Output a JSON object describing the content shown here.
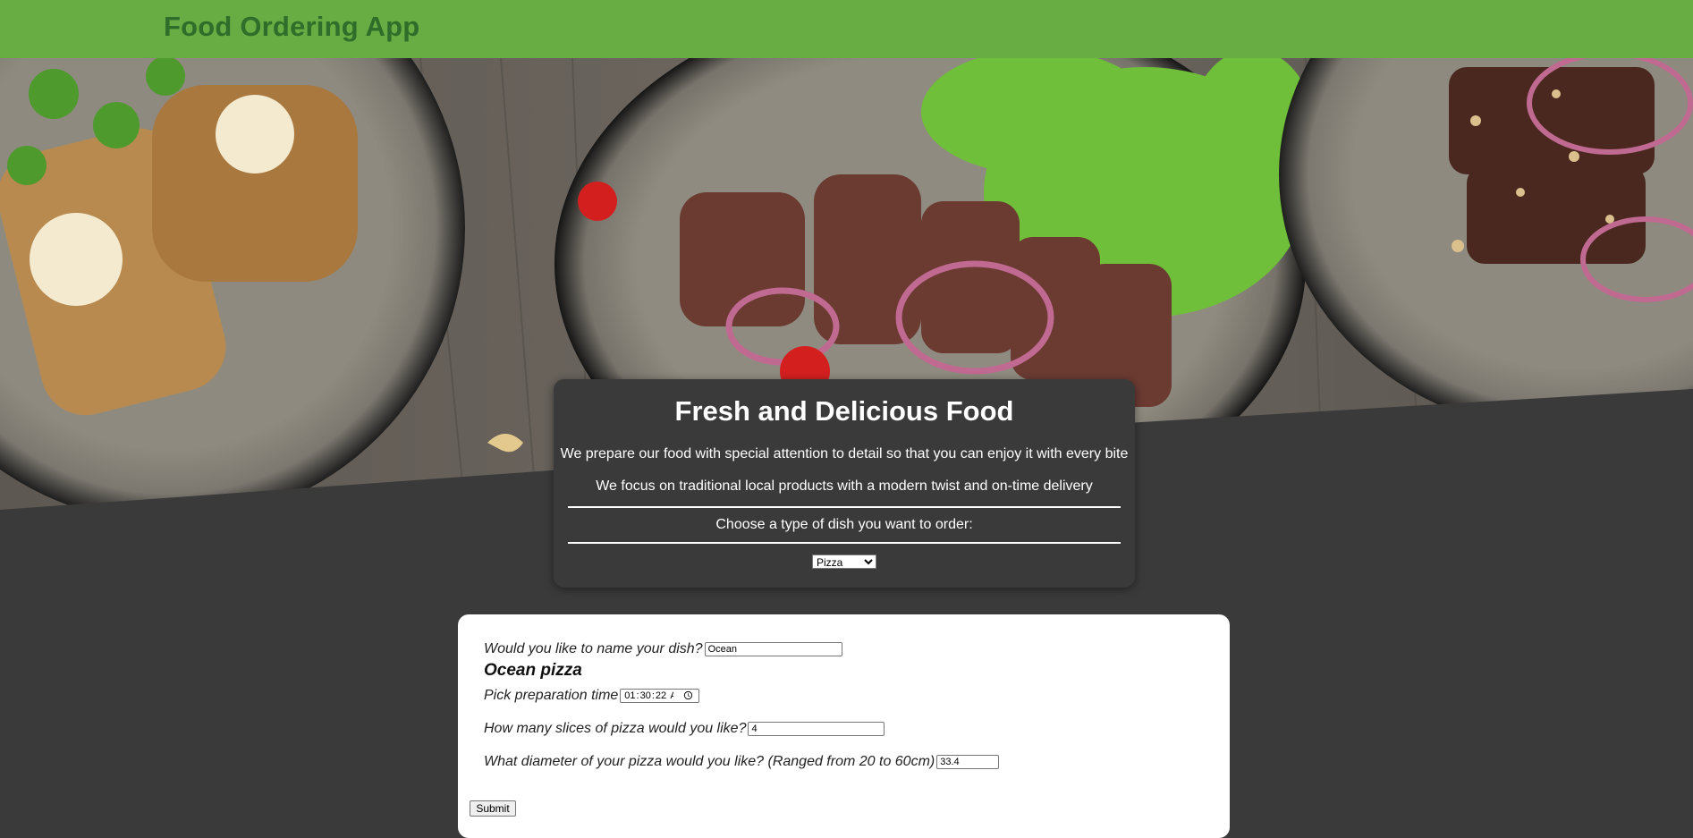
{
  "header": {
    "title": "Food Ordering App"
  },
  "hero": {
    "heading": "Fresh and Delicious Food",
    "line1": "We prepare our food with special attention to detail so that you can enjoy it with every bite",
    "line2": "We focus on traditional local products with a modern twist and on-time delivery",
    "choose_label": "Choose a type of dish you want to order:",
    "dish_select": {
      "selected": "Pizza"
    }
  },
  "form": {
    "name_label": "Would you like to name your dish?",
    "name_value": "Ocean",
    "dish_title": "Ocean pizza",
    "time_label": "Pick preparation time",
    "time_value": "01:30:22",
    "slices_label": "How many slices of pizza would you like?",
    "slices_value": "4",
    "diameter_label": "What diameter of your pizza would you like? (Ranged from 20 to 60cm)",
    "diameter_value": "33.4",
    "submit_label": "Submit"
  },
  "colors": {
    "header_bg": "#67ad43",
    "header_text": "#2f6d2a",
    "page_bg": "#3a3a3a",
    "card_bg": "#ffffff"
  },
  "icons": {
    "time_field": "clock-icon",
    "select_arrow": "chevron-down-icon"
  }
}
